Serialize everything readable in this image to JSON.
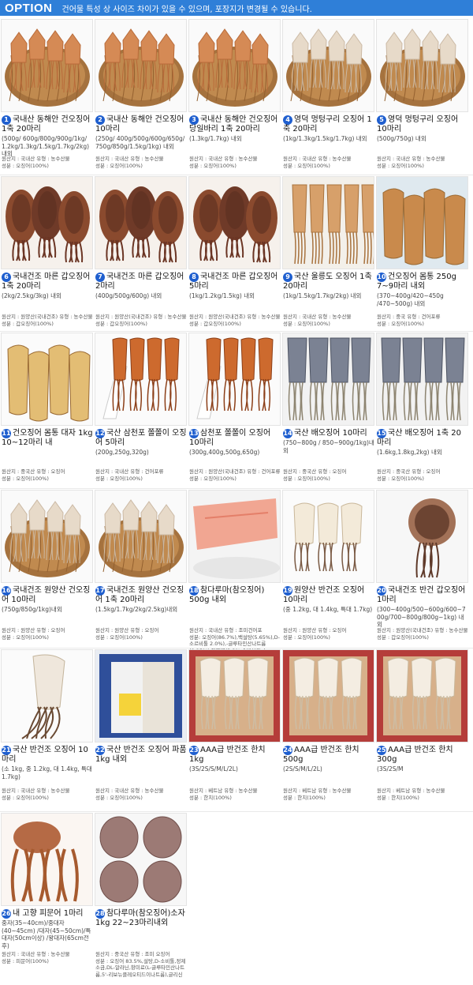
{
  "header": {
    "title": "OPTION",
    "notice": "건어물 특성 상 사이즈 차이가 있을 수 있으며, 포장지가 변경될 수 있습니다."
  },
  "colors": {
    "header_bg": "#2f7fd8",
    "badge": "#1f5fcf"
  },
  "items": [
    {
      "num": "1",
      "title": "국내산 동해안 건오징어 1축 20마리",
      "sub": "(500g/ 600g/800g/900g/1kg/ 1.2kg/1.3kg/1.5kg/1.7kg/2kg) 내외",
      "origin": "원산지 : 국내산 유형 : 농수산물",
      "comp": "성분 : 오징어(100%)",
      "photo": "basket"
    },
    {
      "num": "2",
      "title": "국내산 동해안 건오징어 10마리",
      "sub": "(250g/ 400g/500g/600g/650g/ 750g/850g/1.5kg/1kg) 내외",
      "origin": "원산지 : 국내산 유형 : 농수산물",
      "comp": "성분 : 오징어(100%)",
      "photo": "basket"
    },
    {
      "num": "3",
      "title": "국내산 동해안 건오징어 당일바리 1축 20마리",
      "sub": "(1.3kg/1.7kg) 내외",
      "origin": "원산지 : 국내산 유형 : 농수산물",
      "comp": "성분 : 오징어(100%)",
      "photo": "basket"
    },
    {
      "num": "4",
      "title": "영덕 멍텅구리 오징어 1축 20마리",
      "sub": "(1kg/1.3kg/1.5kg/1.7kg) 내외",
      "origin": "원산지 : 국내산 유형 : 농수산물",
      "comp": "성분 : 오징어(100%)",
      "photo": "basket-white"
    },
    {
      "num": "5",
      "title": "영덕 멍텅구리 오징어 10마리",
      "sub": "(500g/750g) 내외",
      "origin": "원산지 : 국내산 유형 : 농수산물",
      "comp": "성분 : 오징어(100%)",
      "photo": "basket-white"
    },
    {
      "num": "6",
      "title": "국내건조 마른 갑오징어 1축 20마리",
      "sub": "(2kg/2.5kg/3kg) 내외",
      "origin": "원산지 : 원양산(국내건조) 유형 : 농수산물",
      "comp": "성분 : 갑오징어(100%)",
      "photo": "cuttle"
    },
    {
      "num": "7",
      "title": "국내건조 마른 갑오징어 2마리",
      "sub": "(400g/500g/600g) 내외",
      "origin": "원산지 : 원양산(국내건조) 유형 : 농수산물",
      "comp": "성분 : 갑오징어(100%)",
      "photo": "cuttle"
    },
    {
      "num": "8",
      "title": "국내건조 마른 갑오징어 5마리",
      "sub": "(1kg/1.2kg/1.5kg) 내외",
      "origin": "원산지 : 원양산(국내건조) 유형 : 농수산물",
      "comp": "성분 : 갑오징어(100%)",
      "photo": "cuttle"
    },
    {
      "num": "9",
      "title": "국산 울릉도 오징어 1축 20마리",
      "sub": "(1kg/1.5kg/1.7kg/2kg) 내외",
      "origin": "원산지 : 국내산 유형 : 농수산물",
      "comp": "성분 : 오징어(100%)",
      "photo": "hanging"
    },
    {
      "num": "10",
      "title": "건오징어 몸통 250g 7~9마리 내외",
      "sub": "(370~400g/420~450g /470~500g) 내외",
      "origin": "원산지 : 중국 유형 : 건어포류",
      "comp": "성분 : 오징어(100%)",
      "photo": "body"
    },
    {
      "num": "11",
      "title": "건오징어 몸통 대자 1kg 10~12마리 내",
      "sub": "",
      "origin": "원산지 : 중국산 유형 : 오징어",
      "comp": "성분 : 오징어(100%)",
      "photo": "bodybig"
    },
    {
      "num": "12",
      "title": "국산 삼천포 쫄쫄이 오징어 5마리",
      "sub": "(200g,250g,320g)",
      "origin": "원산지 : 국내산 유형 : 건어포류",
      "comp": "성분 : 오징어(100%)",
      "photo": "jjol"
    },
    {
      "num": "13",
      "title": "삼천포 쫄쫄이 오징어 10마리",
      "sub": "(300g,400g,500g,650g)",
      "origin": "원산지 : 원양산(국내건조) 유형 : 건어포류",
      "comp": "성분 : 오징어(100%)",
      "photo": "jjol"
    },
    {
      "num": "14",
      "title": "국산 배오징어 10마리",
      "sub": "(750~800g / 850~900g/1kg)내외",
      "origin": "원산지 : 중국산 유형 : 오징어",
      "comp": "성분 : 오징어(100%)",
      "photo": "bae"
    },
    {
      "num": "15",
      "title": "국산 배오징어 1축 20마리",
      "sub": "(1.6kg,1.8kg,2kg) 내외",
      "origin": "원산지 : 중국산 유형 : 오징어",
      "comp": "성분 : 오징어(100%)",
      "photo": "bae"
    },
    {
      "num": "16",
      "title": "국내건조 원양산 건오징어 10마리",
      "sub": "(750g/850g/1kg)내외",
      "origin": "원산지 : 원양산 유형 : 오징어",
      "comp": "성분 : 오징어(100%)",
      "photo": "basket-white"
    },
    {
      "num": "17",
      "title": "국내건조 원양산 건오징어 1축 20마리",
      "sub": "(1.5kg/1.7kg/2kg/2.5kg)내외",
      "origin": "원산지 : 원양산 유형 : 오징어",
      "comp": "성분 : 오징어(100%)",
      "photo": "basket-white"
    },
    {
      "num": "18",
      "title": "참다루마(참오징어) 500g 내외",
      "sub": "",
      "origin": "원산지 : 국내산 유형 : 조미건어포",
      "comp": "성분: 오징어(86.7%),백설탕(5.65%),D-소르비톨 2.0%),-글루타민산나트륨(0.25%),정제염(3.2% 솔빈산칼륨(0.01%,",
      "photo": "fillet"
    },
    {
      "num": "19",
      "title": "원양산 반건조 오징어 10마리",
      "sub": "(중 1.2kg, 대 1.4kg, 특대 1.7kg)",
      "origin": "원산지 : 원양산 유형 : 오징어",
      "comp": "성분 : 오징어(100%)",
      "photo": "semi"
    },
    {
      "num": "20",
      "title": "국내건조 반건 갑오징어 1마리",
      "sub": "(300~400g/500~600g/600~7 00g/700~800g/800g~1kg) 내외",
      "origin": "원산지 : 원양산(국내건조) 유형 : 농수산물",
      "comp": "성분 : 갑오징어(100%)",
      "photo": "semicuttle"
    },
    {
      "num": "21",
      "title": "국산 반건조 오징어 10마리",
      "sub": "(소 1kg, 중 1.2kg, 대 1.4kg, 특대 1.7kg)",
      "origin": "원산지 : 국내산 유형 : 농수산물",
      "comp": "성분 : 오징어(100%)",
      "photo": "single"
    },
    {
      "num": "22",
      "title": "국산 반건조 오징어 파품 1kg 내외",
      "sub": "",
      "origin": "원산지 : 국내산 유형 : 농수산물",
      "comp": "성분 : 오징어(100%)",
      "photo": "pack"
    },
    {
      "num": "23",
      "title": "AAA급 반건조 한치 1kg",
      "sub": "(3S/2S/S/M/L/2L)",
      "origin": "원산지 : 베트남 유형 : 농수산물",
      "comp": "성분 : 한치(100%)",
      "photo": "hanchi"
    },
    {
      "num": "24",
      "title": "AAA급 반건조 한치 500g",
      "sub": "(2S/S/M/L/2L)",
      "origin": "원산지 : 베트남 유형 : 농수산물",
      "comp": "성분 : 한치(100%)",
      "photo": "hanchi"
    },
    {
      "num": "25",
      "title": "AAA급 반건조 한치 300g",
      "sub": "(3S/2S/M",
      "origin": "원산지 : 베트남 유형 : 농수산물",
      "comp": "성분 : 한치(100%)",
      "photo": "hanchi"
    },
    {
      "num": "26",
      "title": "내 고향 피문어 1마리",
      "sub": "중자(35~40cm)/중대자(40~45cm) /대자(45~50cm)/특대자(50cm이상) /왕대자(65cm전후)",
      "origin": "원산지 : 국내산 유형 : 농수산물",
      "comp": "성분 : 피문어(100%)",
      "photo": "octo"
    },
    {
      "num": "28",
      "title": "참다루마(참오징어)소자 1kg 22~23마리내외",
      "sub": "",
      "origin": "원산지 : 중국산 유형 : 조미 오징어",
      "comp": "성분 : 오징어 83.5%,설탕,D-소비톨,정제소금,DL-알라닌,항미료(L-글루타민산나트륨,5'-리보뉴클레오티드이나트륨),글리신",
      "photo": "daruma"
    }
  ]
}
